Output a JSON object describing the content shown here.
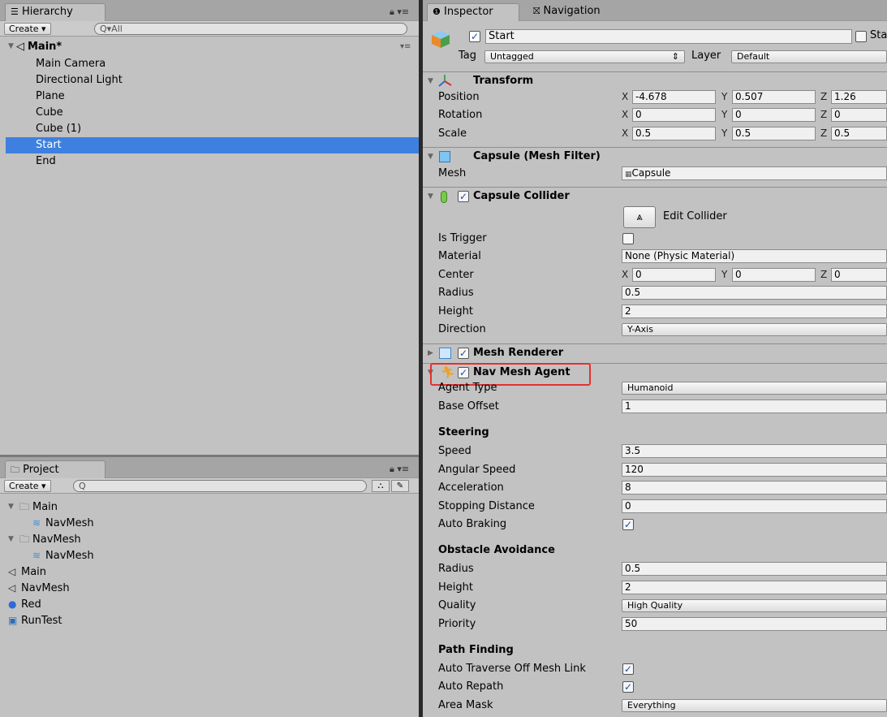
{
  "hierarchy": {
    "tab_label": "Hierarchy",
    "create_label": "Create ▾",
    "search_placeholder": "Q▾All",
    "scene_name": "Main*",
    "items": [
      "Main Camera",
      "Directional Light",
      "Plane",
      "Cube",
      "Cube (1)",
      "Start",
      "End"
    ],
    "selected": "Start"
  },
  "project": {
    "tab_label": "Project",
    "create_label": "Create ▾",
    "search_placeholder": "Q",
    "items": [
      {
        "label": "Main",
        "icon": "folder-icon",
        "indent": 0,
        "foldable": true
      },
      {
        "label": "NavMesh",
        "icon": "navmesh-asset-icon",
        "indent": 1,
        "foldable": false
      },
      {
        "label": "NavMesh",
        "icon": "folder-icon",
        "indent": 0,
        "foldable": true
      },
      {
        "label": "NavMesh",
        "icon": "navmesh-asset-icon",
        "indent": 1,
        "foldable": false
      },
      {
        "label": "Main",
        "icon": "unity-scene-icon",
        "indent": 0,
        "foldable": false
      },
      {
        "label": "NavMesh",
        "icon": "unity-scene-icon",
        "indent": 0,
        "foldable": false
      },
      {
        "label": "Red",
        "icon": "material-sphere-icon",
        "indent": 0,
        "foldable": false
      },
      {
        "label": "RunTest",
        "icon": "csharp-script-icon",
        "indent": 0,
        "foldable": false
      }
    ]
  },
  "inspector": {
    "tab_label": "Inspector",
    "nav_tab_label": "Navigation",
    "object_name": "Start",
    "static_label": "Sta",
    "tag_label": "Tag",
    "tag_value": "Untagged",
    "layer_label": "Layer",
    "layer_value": "Default",
    "transform": {
      "title": "Transform",
      "position_label": "Position",
      "px": "-4.678",
      "py": "0.507",
      "pz": "1.26",
      "rotation_label": "Rotation",
      "rx": "0",
      "ry": "0",
      "rz": "0",
      "scale_label": "Scale",
      "sx": "0.5",
      "sy": "0.5",
      "sz": "0.5"
    },
    "mesh_filter": {
      "title": "Capsule (Mesh Filter)",
      "mesh_label": "Mesh",
      "mesh_value": "Capsule"
    },
    "capsule_collider": {
      "title": "Capsule Collider",
      "edit_label": "Edit Collider",
      "is_trigger_label": "Is Trigger",
      "material_label": "Material",
      "material_value": "None (Physic Material)",
      "center_label": "Center",
      "cx": "0",
      "cy": "0",
      "cz": "0",
      "radius_label": "Radius",
      "radius_value": "0.5",
      "height_label": "Height",
      "height_value": "2",
      "direction_label": "Direction",
      "direction_value": "Y-Axis"
    },
    "mesh_renderer": {
      "title": "Mesh Renderer"
    },
    "nav_mesh_agent": {
      "title": "Nav Mesh Agent",
      "agent_type_label": "Agent Type",
      "agent_type_value": "Humanoid",
      "base_offset_label": "Base Offset",
      "base_offset_value": "1",
      "steering_title": "Steering",
      "speed_label": "Speed",
      "speed_value": "3.5",
      "angular_speed_label": "Angular Speed",
      "angular_speed_value": "120",
      "acceleration_label": "Acceleration",
      "acceleration_value": "8",
      "stopping_distance_label": "Stopping Distance",
      "stopping_distance_value": "0",
      "auto_braking_label": "Auto Braking",
      "obstacle_title": "Obstacle Avoidance",
      "oa_radius_label": "Radius",
      "oa_radius_value": "0.5",
      "oa_height_label": "Height",
      "oa_height_value": "2",
      "quality_label": "Quality",
      "quality_value": "High Quality",
      "priority_label": "Priority",
      "priority_value": "50",
      "path_title": "Path Finding",
      "auto_traverse_label": "Auto Traverse Off Mesh Link",
      "auto_repath_label": "Auto Repath",
      "area_mask_label": "Area Mask",
      "area_mask_value": "Everything"
    },
    "highlight_color": "#e53030"
  },
  "axes": {
    "x": "X",
    "y": "Y",
    "z": "Z"
  },
  "check_glyph": "✓"
}
